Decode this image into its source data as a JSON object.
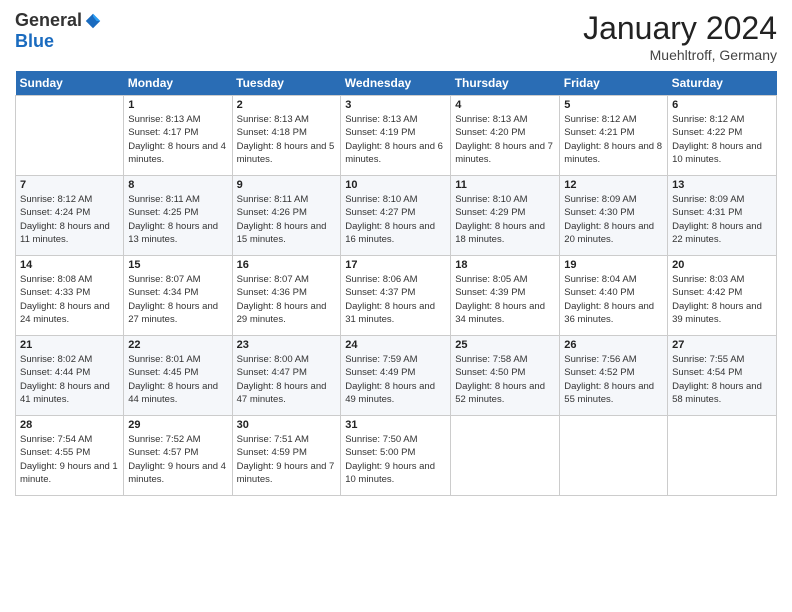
{
  "logo": {
    "general": "General",
    "blue": "Blue"
  },
  "title": "January 2024",
  "location": "Muehltroff, Germany",
  "days_header": [
    "Sunday",
    "Monday",
    "Tuesday",
    "Wednesday",
    "Thursday",
    "Friday",
    "Saturday"
  ],
  "weeks": [
    [
      {
        "day": "",
        "sunrise": "",
        "sunset": "",
        "daylight": ""
      },
      {
        "day": "1",
        "sunrise": "Sunrise: 8:13 AM",
        "sunset": "Sunset: 4:17 PM",
        "daylight": "Daylight: 8 hours and 4 minutes."
      },
      {
        "day": "2",
        "sunrise": "Sunrise: 8:13 AM",
        "sunset": "Sunset: 4:18 PM",
        "daylight": "Daylight: 8 hours and 5 minutes."
      },
      {
        "day": "3",
        "sunrise": "Sunrise: 8:13 AM",
        "sunset": "Sunset: 4:19 PM",
        "daylight": "Daylight: 8 hours and 6 minutes."
      },
      {
        "day": "4",
        "sunrise": "Sunrise: 8:13 AM",
        "sunset": "Sunset: 4:20 PM",
        "daylight": "Daylight: 8 hours and 7 minutes."
      },
      {
        "day": "5",
        "sunrise": "Sunrise: 8:12 AM",
        "sunset": "Sunset: 4:21 PM",
        "daylight": "Daylight: 8 hours and 8 minutes."
      },
      {
        "day": "6",
        "sunrise": "Sunrise: 8:12 AM",
        "sunset": "Sunset: 4:22 PM",
        "daylight": "Daylight: 8 hours and 10 minutes."
      }
    ],
    [
      {
        "day": "7",
        "sunrise": "Sunrise: 8:12 AM",
        "sunset": "Sunset: 4:24 PM",
        "daylight": "Daylight: 8 hours and 11 minutes."
      },
      {
        "day": "8",
        "sunrise": "Sunrise: 8:11 AM",
        "sunset": "Sunset: 4:25 PM",
        "daylight": "Daylight: 8 hours and 13 minutes."
      },
      {
        "day": "9",
        "sunrise": "Sunrise: 8:11 AM",
        "sunset": "Sunset: 4:26 PM",
        "daylight": "Daylight: 8 hours and 15 minutes."
      },
      {
        "day": "10",
        "sunrise": "Sunrise: 8:10 AM",
        "sunset": "Sunset: 4:27 PM",
        "daylight": "Daylight: 8 hours and 16 minutes."
      },
      {
        "day": "11",
        "sunrise": "Sunrise: 8:10 AM",
        "sunset": "Sunset: 4:29 PM",
        "daylight": "Daylight: 8 hours and 18 minutes."
      },
      {
        "day": "12",
        "sunrise": "Sunrise: 8:09 AM",
        "sunset": "Sunset: 4:30 PM",
        "daylight": "Daylight: 8 hours and 20 minutes."
      },
      {
        "day": "13",
        "sunrise": "Sunrise: 8:09 AM",
        "sunset": "Sunset: 4:31 PM",
        "daylight": "Daylight: 8 hours and 22 minutes."
      }
    ],
    [
      {
        "day": "14",
        "sunrise": "Sunrise: 8:08 AM",
        "sunset": "Sunset: 4:33 PM",
        "daylight": "Daylight: 8 hours and 24 minutes."
      },
      {
        "day": "15",
        "sunrise": "Sunrise: 8:07 AM",
        "sunset": "Sunset: 4:34 PM",
        "daylight": "Daylight: 8 hours and 27 minutes."
      },
      {
        "day": "16",
        "sunrise": "Sunrise: 8:07 AM",
        "sunset": "Sunset: 4:36 PM",
        "daylight": "Daylight: 8 hours and 29 minutes."
      },
      {
        "day": "17",
        "sunrise": "Sunrise: 8:06 AM",
        "sunset": "Sunset: 4:37 PM",
        "daylight": "Daylight: 8 hours and 31 minutes."
      },
      {
        "day": "18",
        "sunrise": "Sunrise: 8:05 AM",
        "sunset": "Sunset: 4:39 PM",
        "daylight": "Daylight: 8 hours and 34 minutes."
      },
      {
        "day": "19",
        "sunrise": "Sunrise: 8:04 AM",
        "sunset": "Sunset: 4:40 PM",
        "daylight": "Daylight: 8 hours and 36 minutes."
      },
      {
        "day": "20",
        "sunrise": "Sunrise: 8:03 AM",
        "sunset": "Sunset: 4:42 PM",
        "daylight": "Daylight: 8 hours and 39 minutes."
      }
    ],
    [
      {
        "day": "21",
        "sunrise": "Sunrise: 8:02 AM",
        "sunset": "Sunset: 4:44 PM",
        "daylight": "Daylight: 8 hours and 41 minutes."
      },
      {
        "day": "22",
        "sunrise": "Sunrise: 8:01 AM",
        "sunset": "Sunset: 4:45 PM",
        "daylight": "Daylight: 8 hours and 44 minutes."
      },
      {
        "day": "23",
        "sunrise": "Sunrise: 8:00 AM",
        "sunset": "Sunset: 4:47 PM",
        "daylight": "Daylight: 8 hours and 47 minutes."
      },
      {
        "day": "24",
        "sunrise": "Sunrise: 7:59 AM",
        "sunset": "Sunset: 4:49 PM",
        "daylight": "Daylight: 8 hours and 49 minutes."
      },
      {
        "day": "25",
        "sunrise": "Sunrise: 7:58 AM",
        "sunset": "Sunset: 4:50 PM",
        "daylight": "Daylight: 8 hours and 52 minutes."
      },
      {
        "day": "26",
        "sunrise": "Sunrise: 7:56 AM",
        "sunset": "Sunset: 4:52 PM",
        "daylight": "Daylight: 8 hours and 55 minutes."
      },
      {
        "day": "27",
        "sunrise": "Sunrise: 7:55 AM",
        "sunset": "Sunset: 4:54 PM",
        "daylight": "Daylight: 8 hours and 58 minutes."
      }
    ],
    [
      {
        "day": "28",
        "sunrise": "Sunrise: 7:54 AM",
        "sunset": "Sunset: 4:55 PM",
        "daylight": "Daylight: 9 hours and 1 minute."
      },
      {
        "day": "29",
        "sunrise": "Sunrise: 7:52 AM",
        "sunset": "Sunset: 4:57 PM",
        "daylight": "Daylight: 9 hours and 4 minutes."
      },
      {
        "day": "30",
        "sunrise": "Sunrise: 7:51 AM",
        "sunset": "Sunset: 4:59 PM",
        "daylight": "Daylight: 9 hours and 7 minutes."
      },
      {
        "day": "31",
        "sunrise": "Sunrise: 7:50 AM",
        "sunset": "Sunset: 5:00 PM",
        "daylight": "Daylight: 9 hours and 10 minutes."
      },
      {
        "day": "",
        "sunrise": "",
        "sunset": "",
        "daylight": ""
      },
      {
        "day": "",
        "sunrise": "",
        "sunset": "",
        "daylight": ""
      },
      {
        "day": "",
        "sunrise": "",
        "sunset": "",
        "daylight": ""
      }
    ]
  ]
}
